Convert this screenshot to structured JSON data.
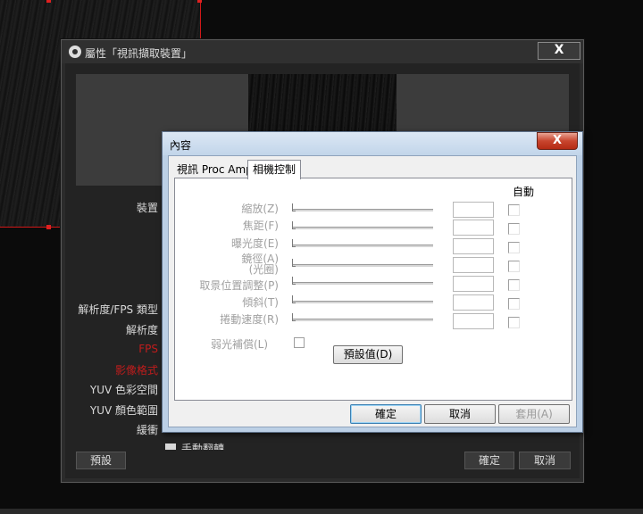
{
  "obs_window": {
    "title": "屬性「視訊擷取裝置」",
    "close_label": "X",
    "labels": {
      "device": "裝置",
      "resolution_fps_type": "解析度/FPS 類型",
      "resolution": "解析度",
      "fps": "FPS",
      "video_format": "影像格式",
      "yuv_color_space": "YUV 色彩空間",
      "yuv_color_range": "YUV 顏色範圍",
      "buffering": "緩衝"
    },
    "checkbox_label": "手動翻轉",
    "defaults_button": "預設",
    "ok_button": "確定",
    "cancel_button": "取消",
    "accent_red": "#c11c1c"
  },
  "dialog": {
    "title": "內容",
    "close_label": "X",
    "tabs": [
      {
        "label": "視訊 Proc Amp",
        "selected": false
      },
      {
        "label": "相機控制",
        "selected": true
      }
    ],
    "auto_header": "自動",
    "rows": [
      {
        "label": "縮放(Z)",
        "value": "",
        "auto": false
      },
      {
        "label": "焦距(F)",
        "value": "",
        "auto": false
      },
      {
        "label": "曝光度(E)",
        "value": "",
        "auto": false
      },
      {
        "label": "鏡徑(A)",
        "label_line2": "(光圈)",
        "value": "",
        "auto": false
      },
      {
        "label": "取景位置調整(P)",
        "value": "",
        "auto": false
      },
      {
        "label": "傾斜(T)",
        "value": "",
        "auto": false
      },
      {
        "label": "捲動速度(R)",
        "value": "",
        "auto": false
      }
    ],
    "backlight_label": "弱光補償(L)",
    "defaults_button": "預設值(D)",
    "ok_button": "確定",
    "cancel_button": "取消",
    "apply_button": "套用(A)"
  }
}
